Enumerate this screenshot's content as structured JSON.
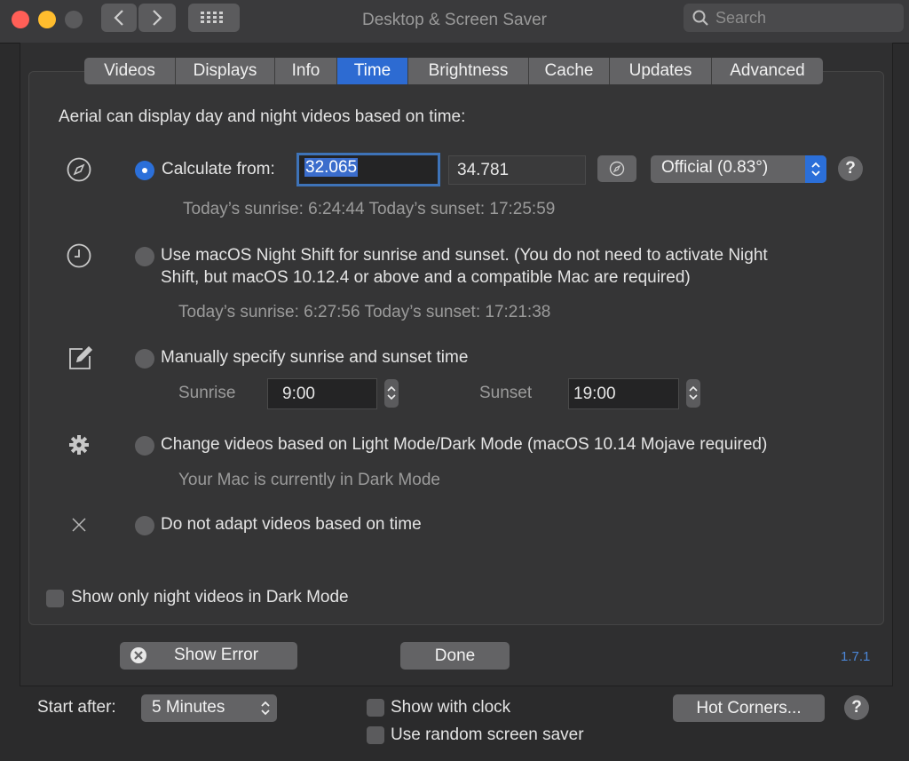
{
  "window": {
    "title": "Desktop & Screen Saver",
    "search_placeholder": "Search"
  },
  "tabs": [
    {
      "label": "Videos",
      "active": false
    },
    {
      "label": "Displays",
      "active": false
    },
    {
      "label": "Info",
      "active": false
    },
    {
      "label": "Time",
      "active": true
    },
    {
      "label": "Brightness",
      "active": false
    },
    {
      "label": "Cache",
      "active": false
    },
    {
      "label": "Updates",
      "active": false
    },
    {
      "label": "Advanced",
      "active": false
    }
  ],
  "time": {
    "intro": "Aerial can display day and night videos based on time:",
    "calculate": {
      "label": "Calculate from:",
      "latitude": "32.065",
      "longitude": "34.781",
      "mode": "Official (0.83°)",
      "info": "Today’s sunrise: 6:24:44  Today’s sunset: 17:25:59"
    },
    "nightshift": {
      "label_line1": "Use macOS Night Shift for sunrise and sunset. (You do not need to activate Night",
      "label_line2": "Shift, but macOS 10.12.4 or above and a compatible Mac are required)",
      "info": "Today’s sunrise: 6:27:56  Today’s sunset: 17:21:38"
    },
    "manual": {
      "label": "Manually specify sunrise and sunset time",
      "sunrise_label": "Sunrise",
      "sunrise_value": "9:00",
      "sunset_label": "Sunset",
      "sunset_value": "19:00"
    },
    "darkmode": {
      "label": "Change videos based on Light Mode/Dark Mode (macOS 10.14 Mojave required)",
      "info": "Your Mac is currently in Dark Mode"
    },
    "none": {
      "label": "Do not adapt videos based on time"
    },
    "night_only_label": "Show only night videos in Dark Mode",
    "help_glyph": "?"
  },
  "sheet_buttons": {
    "show_error": "Show Error",
    "done": "Done",
    "version": "1.7.1"
  },
  "footer": {
    "start_after_label": "Start after:",
    "start_after_value": "5 Minutes",
    "show_clock_label": "Show with clock",
    "random_saver_label": "Use random screen saver",
    "hot_corners_label": "Hot Corners...",
    "help_glyph": "?"
  },
  "colors": {
    "accent": "#2b6fd9",
    "close": "#ff5f57",
    "minimize": "#ffbd2e",
    "zoom_disabled": "#5a5a5c",
    "version_link": "#4b86d6"
  }
}
